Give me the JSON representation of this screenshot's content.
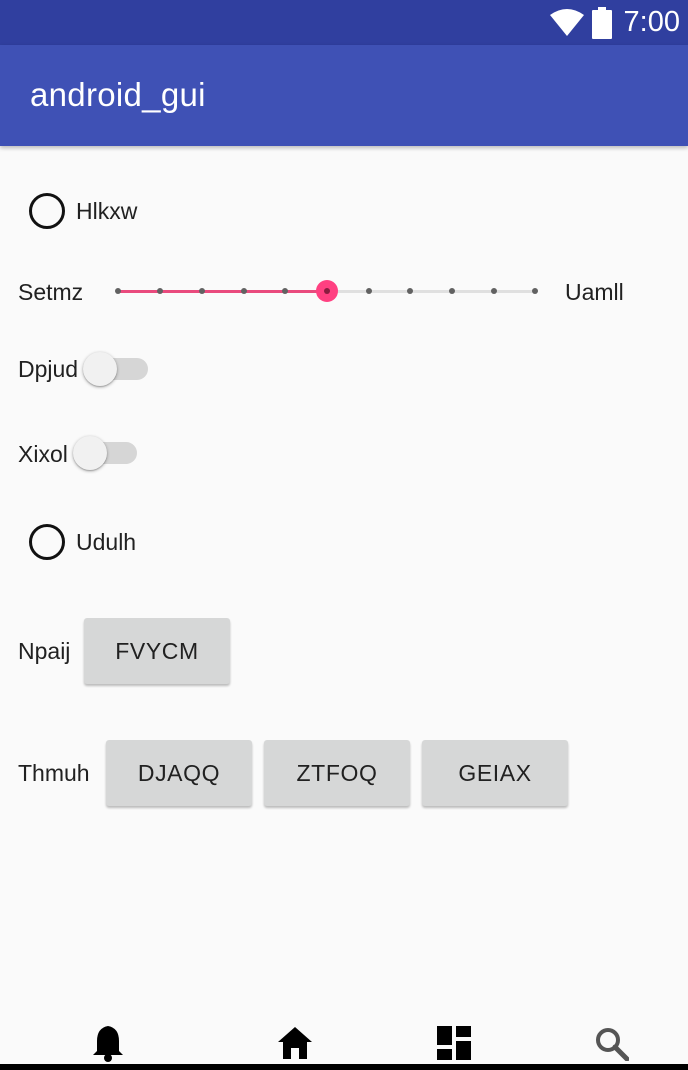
{
  "status_bar": {
    "time": "7:00",
    "icons": [
      "wifi-icon",
      "battery-icon"
    ]
  },
  "app_bar": {
    "title": "android_gui"
  },
  "form": {
    "radio1_label": "Hlkxw",
    "seek_left_label": "Setmz",
    "seek_right_label": "Uamll",
    "seek_progress": 0.5,
    "switch1_label": "Dpjud",
    "switch2_label": "Xixol",
    "radio2_label": "Udulh",
    "row1_label": "Npaij",
    "row1_button": "FVYCM",
    "row2_label": "Thmuh",
    "row2_buttons": [
      "DJAQQ",
      "ZTFOQ",
      "GEIAX"
    ]
  },
  "bottom_nav": {
    "icons": [
      "bell-icon",
      "home-icon",
      "dashboard-icon",
      "search-icon"
    ]
  },
  "colors": {
    "primary": "#3f51b5",
    "primary_dark": "#303f9f",
    "accent": "#ff4081"
  }
}
